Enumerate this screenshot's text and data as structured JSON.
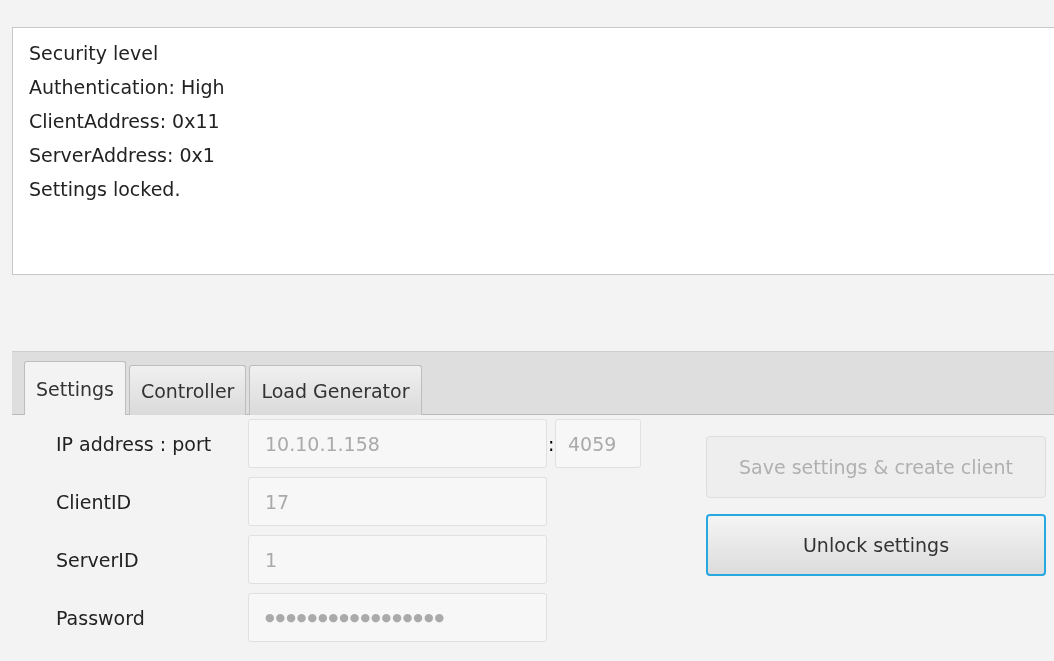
{
  "log": {
    "lines": [
      "Security level",
      "Authentication: High",
      "ClientAddress: 0x11",
      "ServerAddress: 0x1",
      "Settings locked."
    ]
  },
  "tabs": [
    {
      "label": "Settings",
      "selected": true
    },
    {
      "label": "Controller",
      "selected": false
    },
    {
      "label": "Load Generator",
      "selected": false
    }
  ],
  "form": {
    "ip_label": "IP address : port",
    "ip": {
      "value": "10.10.1.158",
      "disabled": true
    },
    "separator": ":",
    "port": {
      "value": "4059",
      "disabled": true
    },
    "fields": [
      {
        "label": "ClientID",
        "value": "17",
        "disabled": true
      },
      {
        "label": "ServerID",
        "value": "1",
        "disabled": true
      },
      {
        "label": "Password",
        "kind": "password",
        "value": "●●●●●●●●●●●●●●●●●",
        "disabled": true
      }
    ]
  },
  "buttons": [
    {
      "label": "Save settings & create client",
      "disabled": true,
      "focused": false
    },
    {
      "label": "Unlock settings",
      "disabled": false,
      "focused": true
    }
  ]
}
